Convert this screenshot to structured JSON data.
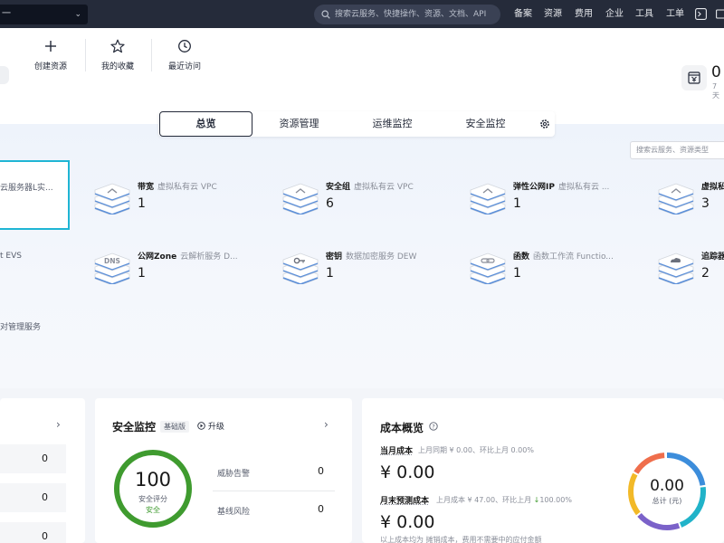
{
  "topbar": {
    "region_text": "一",
    "search_placeholder": "搜索云服务、快捷操作、资源、文档、API",
    "nav": [
      "备案",
      "资源",
      "费用",
      "企业",
      "工具",
      "工单"
    ]
  },
  "quick_actions": [
    {
      "label": "创建资源",
      "icon": "plus-icon"
    },
    {
      "label": "我的收藏",
      "icon": "star-icon"
    },
    {
      "label": "最近访问",
      "icon": "clock-icon"
    }
  ],
  "cost_summary": {
    "value": "0",
    "sub": "7天"
  },
  "tabs": [
    {
      "label": "总览",
      "active": true
    },
    {
      "label": "资源管理",
      "active": false
    },
    {
      "label": "运维监控",
      "active": false
    },
    {
      "label": "安全监控",
      "active": false
    }
  ],
  "resource_search_placeholder": "搜索云服务、资源类型",
  "left_fragments": {
    "selected_card_text": "云服务器L实...",
    "evs_text": "t EVS",
    "mgmt_text": "对管理服务"
  },
  "resources": [
    {
      "name": "带宽",
      "service": "虚拟私有云 VPC",
      "count": "1"
    },
    {
      "name": "安全组",
      "service": "虚拟私有云 VPC",
      "count": "6"
    },
    {
      "name": "弹性公网IP",
      "service": "虚拟私有云 ...",
      "count": "1"
    },
    {
      "name": "虚拟私",
      "service": "",
      "count": "3"
    },
    {
      "name": "公网Zone",
      "service": "云解析服务 D...",
      "count": "1"
    },
    {
      "name": "密钥",
      "service": "数据加密服务 DEW",
      "count": "1"
    },
    {
      "name": "函数",
      "service": "函数工作流 Functio...",
      "count": "1"
    },
    {
      "name": "追踪器",
      "service": "",
      "count": "2"
    }
  ],
  "stack_icons": [
    "upload-icon",
    "upload-icon",
    "upload-icon",
    "upload-icon",
    "dns-icon",
    "key-icon",
    "link-icon",
    "cloud-icon"
  ],
  "left_card": {
    "values": [
      "0",
      "0",
      "0"
    ]
  },
  "security": {
    "title": "安全监控",
    "tag": "基础版",
    "upgrade": "升级",
    "score": "100",
    "score_label": "安全评分",
    "score_status": "安全",
    "rows": [
      {
        "label": "威胁告警",
        "value": "0"
      },
      {
        "label": "基线风险",
        "value": "0"
      }
    ]
  },
  "cost": {
    "title": "成本概览",
    "month_label": "当月成本",
    "month_sub": "上月同期 ¥ 0.00、环比上月",
    "month_pct": "0.00%",
    "month_amount": "¥ 0.00",
    "forecast_label": "月末预测成本",
    "forecast_sub": "上月成本 ¥ 47.00、环比上月",
    "forecast_pct": "100.00%",
    "forecast_amount": "¥ 0.00",
    "footer": "以上成本均为 摊销成本，费用不需要中的应付金额",
    "donut_value": "0.00",
    "donut_label": "总计 (元)"
  },
  "colors": {
    "accent_green": "#3f9b2f",
    "selected_border": "#1fb5d4",
    "topbar_bg": "#252b3a",
    "donut": [
      "#3c8ddb",
      "#21b3c9",
      "#7b62c9",
      "#f2b928",
      "#ef6e4c"
    ]
  }
}
